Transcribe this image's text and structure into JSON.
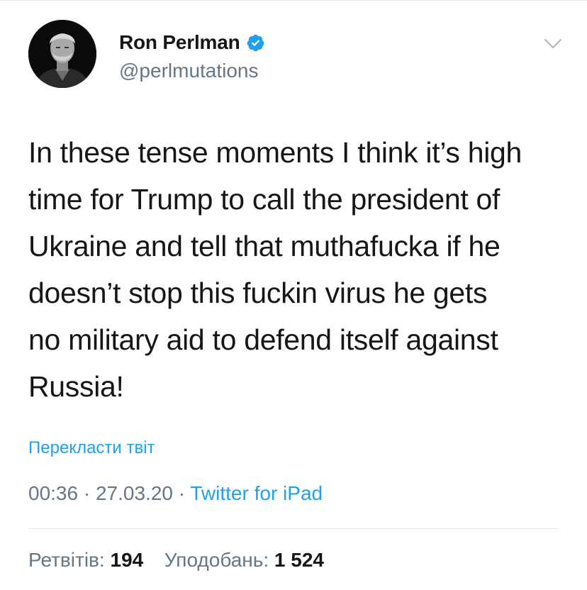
{
  "tweet": {
    "author": {
      "display_name": "Ron Perlman",
      "handle": "@perlmutations",
      "verified": true,
      "avatar_icon": "profile-photo"
    },
    "text_lines": [
      "In these tense moments I think it’s high",
      "time for Trump to call the president of",
      "Ukraine and tell that muthafucka if he",
      "doesn’t stop this fuckin virus he gets",
      "no military aid to defend itself against",
      "Russia!"
    ],
    "translate_label": "Перекласти твіт",
    "time": "00:36",
    "separator": "·",
    "date": "27.03.20",
    "source": "Twitter for iPad",
    "stats": {
      "retweets_label": "Ретвітів:",
      "retweets_count": "194",
      "likes_label": "Уподобань:",
      "likes_count": "1 524"
    }
  },
  "icons": {
    "verified": "verified-badge-icon",
    "menu": "chevron-down-icon"
  },
  "colors": {
    "accent": "#1da1f2",
    "text": "#14171a",
    "secondary": "#657786",
    "border": "#e1e8ed"
  }
}
